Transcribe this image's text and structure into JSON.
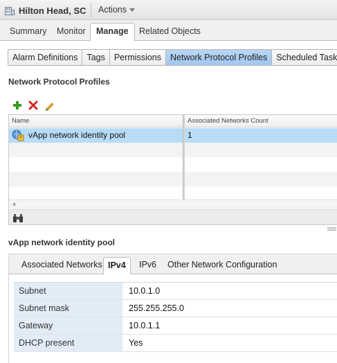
{
  "header": {
    "title": "Hilton Head, SC",
    "actions_label": "Actions"
  },
  "main_tabs": [
    {
      "label": "Summary"
    },
    {
      "label": "Monitor"
    },
    {
      "label": "Manage"
    },
    {
      "label": "Related Objects"
    }
  ],
  "sub_tabs": [
    {
      "label": "Alarm Definitions"
    },
    {
      "label": "Tags"
    },
    {
      "label": "Permissions"
    },
    {
      "label": "Network Protocol Profiles"
    },
    {
      "label": "Scheduled Tasks"
    }
  ],
  "profiles": {
    "title": "Network Protocol Profiles",
    "toolbar": [
      "add-icon",
      "delete-icon",
      "edit-icon"
    ],
    "columns": [
      "Name",
      "Associated Networks Count"
    ],
    "rows": [
      {
        "name": "vApp network identity pool",
        "count": "1"
      }
    ]
  },
  "details": {
    "title": "vApp network identity pool",
    "tabs": [
      {
        "label": "Associated Networks"
      },
      {
        "label": "IPv4"
      },
      {
        "label": "IPv6"
      },
      {
        "label": "Other Network Configuration"
      }
    ],
    "properties": [
      {
        "label": "Subnet",
        "value": "10.0.1.0"
      },
      {
        "label": "Subnet mask",
        "value": "255.255.255.0"
      },
      {
        "label": "Gateway",
        "value": "10.0.1.1"
      },
      {
        "label": "DHCP present",
        "value": "Yes"
      }
    ]
  },
  "colors": {
    "selection": "#b8dcf6",
    "active_subtab": "#a3c6ef",
    "property_label_bg": "#e1ecf6"
  }
}
